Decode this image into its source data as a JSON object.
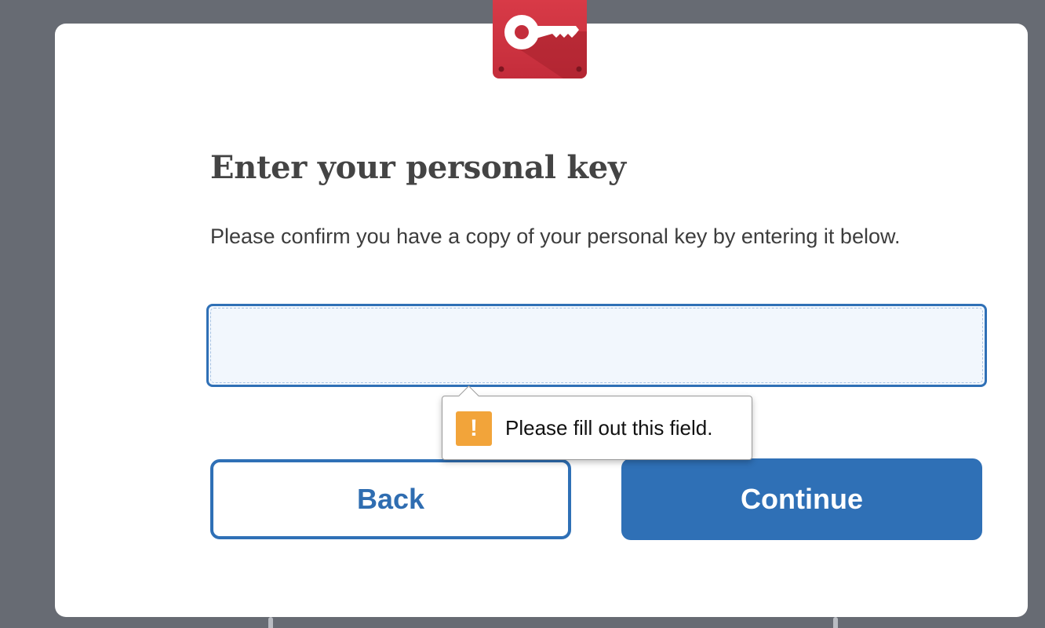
{
  "colors": {
    "primary": "#2f70b6",
    "badge_red": "#c42d3b",
    "warning": "#f2a43a",
    "backdrop": "#676b73"
  },
  "icons": {
    "badge": "key-icon",
    "tooltip": "exclamation-icon"
  },
  "dialog": {
    "title": "Enter your personal key",
    "description": "Please confirm you have a copy of your personal key by entering it below.",
    "input": {
      "value": "",
      "placeholder": ""
    },
    "validation_tooltip": {
      "message": "Please fill out this field.",
      "icon_glyph": "!"
    },
    "buttons": {
      "back_label": "Back",
      "continue_label": "Continue"
    }
  }
}
